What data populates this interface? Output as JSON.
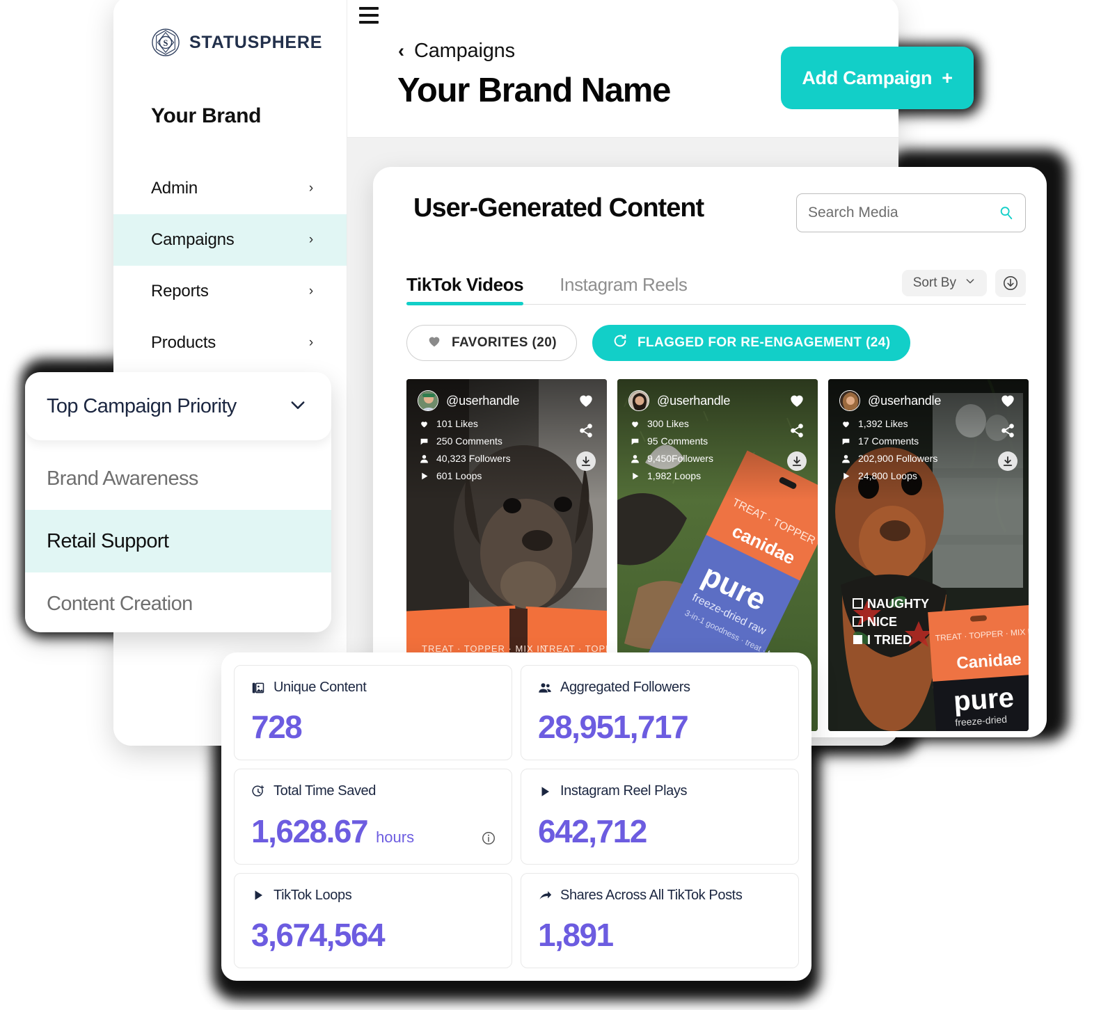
{
  "brand": {
    "logo_text": "STATUSPHERE",
    "logo_mark": "statusphere-gem-icon",
    "workspace": "Your Brand"
  },
  "sidebar": {
    "items": [
      {
        "label": "Admin",
        "chevron": "›",
        "active": false
      },
      {
        "label": "Campaigns",
        "chevron": "›",
        "active": true
      },
      {
        "label": "Reports",
        "chevron": "›",
        "active": false
      },
      {
        "label": "Products",
        "chevron": "›",
        "active": false
      }
    ]
  },
  "header": {
    "menu_icon": "hamburger-icon",
    "back_chevron": "‹",
    "breadcrumb": "Campaigns",
    "title": "Your Brand Name",
    "add_campaign_label": "Add Campaign",
    "add_campaign_plus": "+"
  },
  "ugc": {
    "title": "User-Generated Content",
    "search_placeholder": "Search Media",
    "search_value": "",
    "search_icon": "search-icon",
    "tabs": [
      {
        "label": "TikTok Videos",
        "active": true
      },
      {
        "label": "Instagram Reels",
        "active": false
      }
    ],
    "sort_by_label": "Sort By",
    "sort_chevron": "∨",
    "download_icon": "download-circle-icon",
    "chips": [
      {
        "label": "FAVORITES (20)",
        "icon": "heart-icon",
        "style": "ghost"
      },
      {
        "label": "FLAGGED FOR RE-ENGAGEMENT (24)",
        "icon": "refresh-icon",
        "style": "solid"
      }
    ],
    "cards": [
      {
        "handle": "@userhandle",
        "stats": [
          {
            "icon": "heart-icon",
            "text": "101 Likes"
          },
          {
            "icon": "comment-icon",
            "text": "250 Comments"
          },
          {
            "icon": "person-icon",
            "text": "40,323 Followers"
          },
          {
            "icon": "play-icon",
            "text": "601 Loops"
          }
        ],
        "actions": [
          "heart-icon",
          "share-icon",
          "download-icon"
        ]
      },
      {
        "handle": "@userhandle",
        "stats": [
          {
            "icon": "heart-icon",
            "text": "300 Likes"
          },
          {
            "icon": "comment-icon",
            "text": "95 Comments"
          },
          {
            "icon": "person-icon",
            "text": "9,450Followers"
          },
          {
            "icon": "play-icon",
            "text": "1,982 Loops"
          }
        ],
        "actions": [
          "heart-icon",
          "share-icon",
          "download-icon"
        ]
      },
      {
        "handle": "@userhandle",
        "stats": [
          {
            "icon": "heart-icon",
            "text": "1,392 Likes"
          },
          {
            "icon": "comment-icon",
            "text": "17 Comments"
          },
          {
            "icon": "person-icon",
            "text": "202,900 Followers"
          },
          {
            "icon": "play-icon",
            "text": "24,800 Loops"
          }
        ],
        "actions": [
          "heart-icon",
          "share-icon",
          "download-icon"
        ]
      }
    ]
  },
  "priority_dropdown": {
    "label": "Top Campaign Priority",
    "chevron": "chevron-down-icon",
    "options": [
      {
        "label": "Brand Awareness",
        "selected": false
      },
      {
        "label": "Retail Support",
        "selected": true
      },
      {
        "label": "Content Creation",
        "selected": false
      }
    ]
  },
  "metrics": [
    {
      "label": "Unique Content",
      "icon": "image-stack-icon",
      "value": "728",
      "unit": "",
      "info": false
    },
    {
      "label": "Aggregated Followers",
      "icon": "people-icon",
      "value": "28,951,717",
      "unit": "",
      "info": false
    },
    {
      "label": "Total Time Saved",
      "icon": "clock-plus-icon",
      "value": "1,628.67",
      "unit": "hours",
      "info": true
    },
    {
      "label": "Instagram Reel Plays",
      "icon": "play-icon",
      "value": "642,712",
      "unit": "",
      "info": false
    },
    {
      "label": "TikTok Loops",
      "icon": "play-icon",
      "value": "3,674,564",
      "unit": "",
      "info": false
    },
    {
      "label": "Shares Across All TikTok Posts",
      "icon": "share-arrow-icon",
      "value": "1,891",
      "unit": "",
      "info": false
    }
  ],
  "colors": {
    "accent_teal": "#12CFC8",
    "accent_mint": "#e1f6f4",
    "metric_purple": "#6C5CE0",
    "navy": "#1b2640"
  }
}
